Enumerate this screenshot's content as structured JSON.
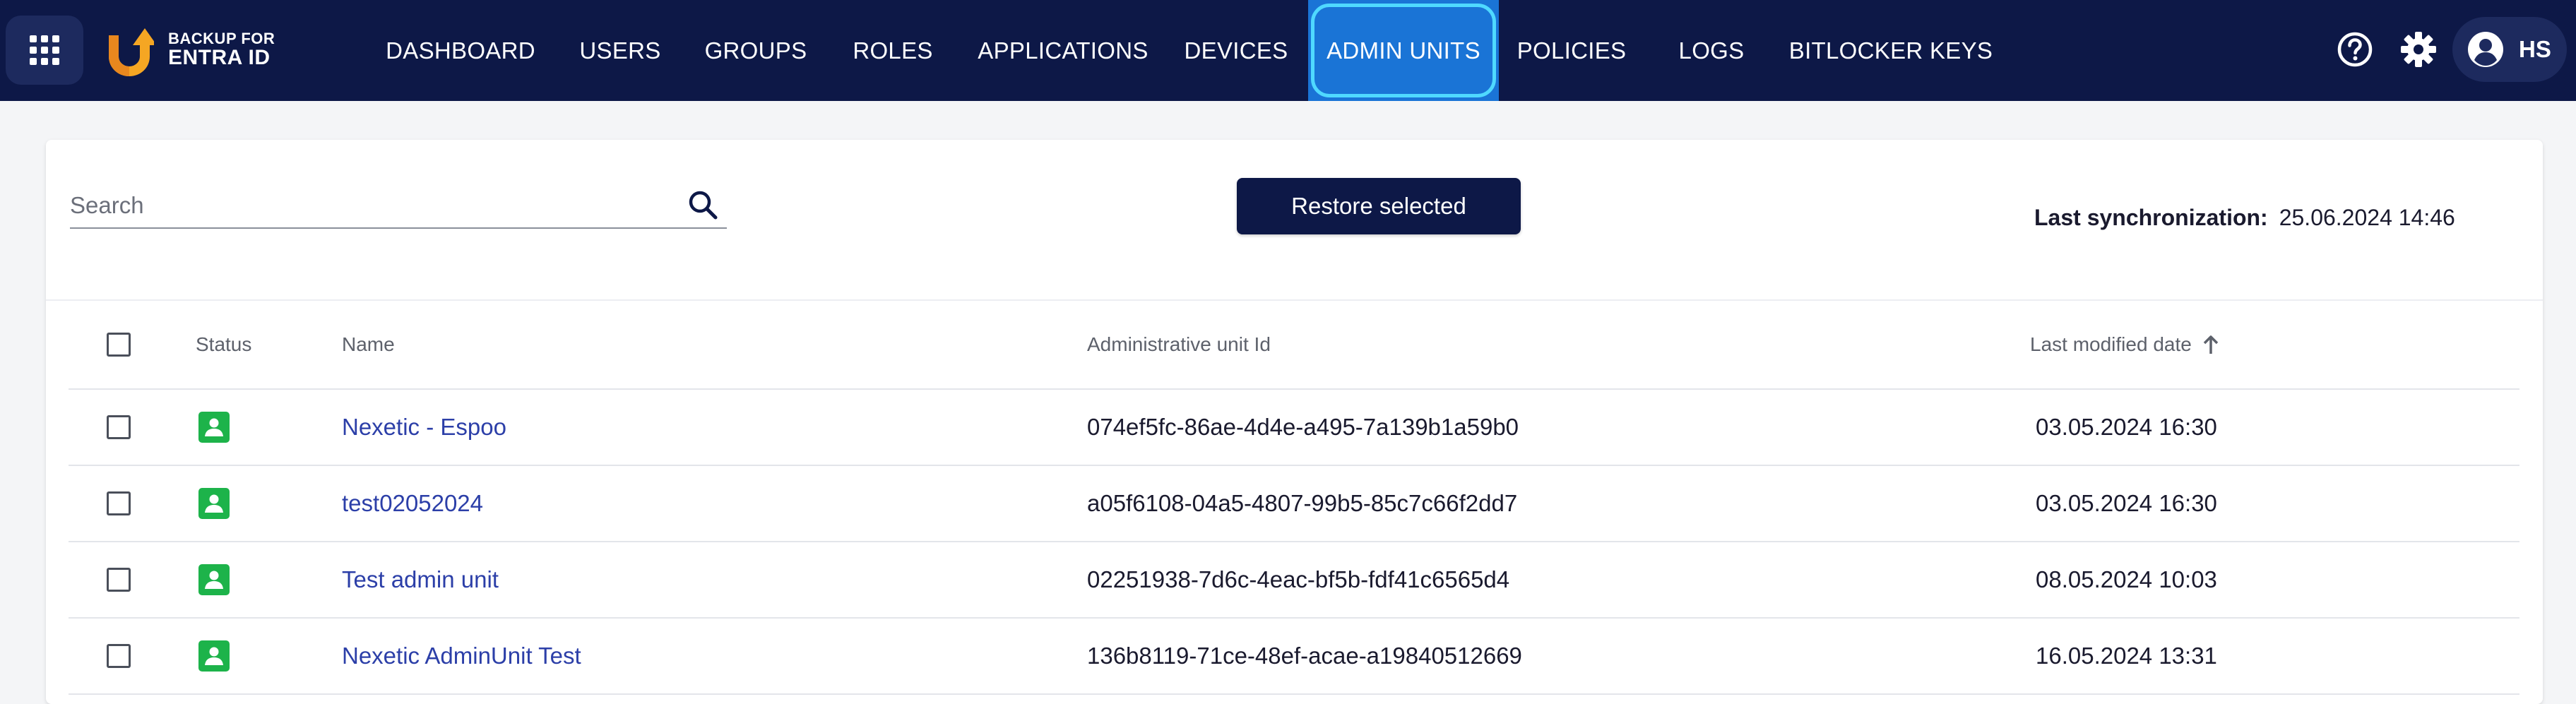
{
  "app": {
    "logo_line1": "BACKUP FOR",
    "logo_line2": "ENTRA ID",
    "accent_color": "#1a74d6",
    "header_color": "#0d1847"
  },
  "nav": {
    "items": [
      {
        "label": "DASHBOARD"
      },
      {
        "label": "USERS"
      },
      {
        "label": "GROUPS"
      },
      {
        "label": "ROLES"
      },
      {
        "label": "APPLICATIONS"
      },
      {
        "label": "DEVICES"
      },
      {
        "label": "ADMIN UNITS",
        "active": true
      },
      {
        "label": "POLICIES"
      },
      {
        "label": "LOGS"
      },
      {
        "label": "BITLOCKER KEYS"
      }
    ]
  },
  "header_icons": {
    "help": "help-icon",
    "settings": "gear-icon",
    "account": "account-circle-icon",
    "user_initials": "HS"
  },
  "toolbar": {
    "search_placeholder": "Search",
    "search_value": "",
    "restore_label": "Restore selected",
    "sync_label": "Last synchronization:",
    "sync_value": "25.06.2024 14:46"
  },
  "table": {
    "columns": {
      "status": "Status",
      "name": "Name",
      "id": "Administrative unit Id",
      "modified": "Last modified date"
    },
    "sort": {
      "column": "modified",
      "direction": "ascending"
    },
    "status_color": "#1db34a",
    "rows": [
      {
        "name": "Nexetic - Espoo",
        "id": "074ef5fc-86ae-4d4e-a495-7a139b1a59b0",
        "modified": "03.05.2024 16:30",
        "status": "active",
        "checked": false
      },
      {
        "name": "test02052024",
        "id": "a05f6108-04a5-4807-99b5-85c7c66f2dd7",
        "modified": "03.05.2024 16:30",
        "status": "active",
        "checked": false
      },
      {
        "name": "Test admin unit",
        "id": "02251938-7d6c-4eac-bf5b-fdf41c6565d4",
        "modified": "08.05.2024 10:03",
        "status": "active",
        "checked": false
      },
      {
        "name": "Nexetic AdminUnit Test",
        "id": "136b8119-71ce-48ef-acae-a19840512669",
        "modified": "16.05.2024 13:31",
        "status": "active",
        "checked": false
      }
    ]
  }
}
